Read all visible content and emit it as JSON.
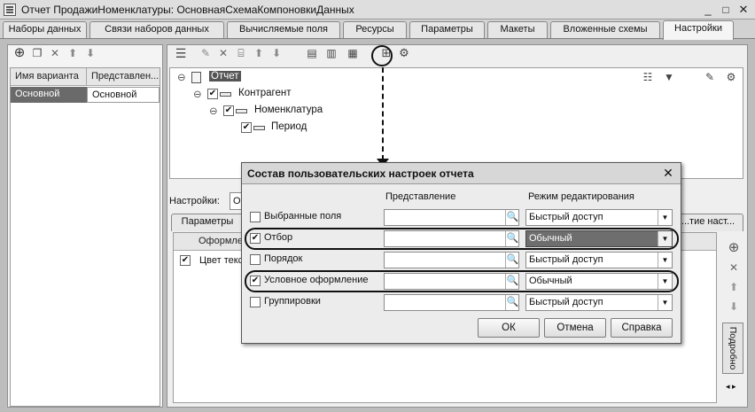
{
  "window": {
    "title": "Отчет ПродажиНоменклатуры: ОсновнаяСхемаКомпоновкиДанных"
  },
  "tabs": [
    {
      "label": "Наборы данных"
    },
    {
      "label": "Связи наборов данных"
    },
    {
      "label": "Вычисляемые поля"
    },
    {
      "label": "Ресурсы"
    },
    {
      "label": "Параметры"
    },
    {
      "label": "Макеты"
    },
    {
      "label": "Вложенные схемы"
    },
    {
      "label": "Настройки"
    }
  ],
  "variants": {
    "columns": [
      "Имя варианта",
      "Представлен..."
    ],
    "rows": [
      {
        "name": "Основной",
        "presentation": "Основной"
      }
    ]
  },
  "tree": {
    "root": "Отчет",
    "items": [
      {
        "label": "Контрагент"
      },
      {
        "label": "Номенклатура"
      },
      {
        "label": "Период"
      }
    ]
  },
  "settings": {
    "label": "Настройки:",
    "value": "О",
    "subtabs": [
      "Параметры",
      "...тие наст..."
    ],
    "grid_header": "Оформле",
    "grid_cell": "Цвет текс",
    "side_tab": "Подробно"
  },
  "dialog": {
    "title": "Состав пользовательских настроек отчета",
    "col_presentation": "Представление",
    "col_mode": "Режим редактирования",
    "rows": [
      {
        "label": "Выбранные поля",
        "checked": false,
        "mode": "Быстрый доступ"
      },
      {
        "label": "Отбор",
        "checked": true,
        "mode": "Обычный"
      },
      {
        "label": "Порядок",
        "checked": false,
        "mode": "Быстрый доступ"
      },
      {
        "label": "Условное оформление",
        "checked": true,
        "mode": "Обычный"
      },
      {
        "label": "Группировки",
        "checked": false,
        "mode": "Быстрый доступ"
      }
    ],
    "ok": "ОК",
    "cancel": "Отмена",
    "help": "Справка"
  }
}
